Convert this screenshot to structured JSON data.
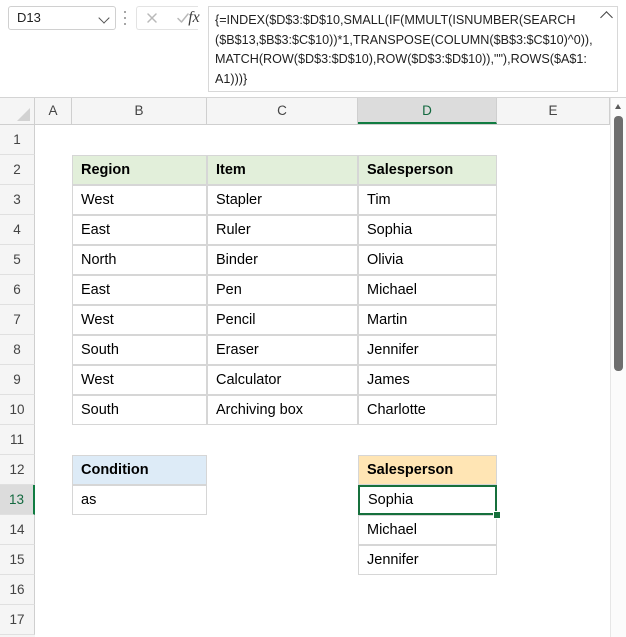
{
  "app": "excel-spreadsheet",
  "formula_bar": {
    "name_box_value": "D13",
    "name_box_icon": "chevron-down-icon",
    "cancel_icon": "cancel-x-icon",
    "enter_icon": "enter-check-icon",
    "fx_label": "fx",
    "formula": "{=INDEX($D$3:$D$10,SMALL(IF(MMULT(ISNUMBER(SEARCH($B$13,$B$3:$C$10))*1,TRANSPOSE(COLUMN($B$3:$C$10)^0)),MATCH(ROW($D$3:$D$10),ROW($D$3:$D$10)),\"\"),ROWS($A$1:A1)))}",
    "collapse_icon": "chevron-up-icon"
  },
  "grid": {
    "column_headers": [
      "A",
      "B",
      "C",
      "D",
      "E"
    ],
    "active_column": "D",
    "row_headers": [
      "1",
      "2",
      "3",
      "4",
      "5",
      "6",
      "7",
      "8",
      "9",
      "10",
      "11",
      "12",
      "13",
      "14",
      "15",
      "16",
      "17"
    ],
    "active_row": "13",
    "select_all_icon": "select-all-triangle-icon"
  },
  "data_table": {
    "headers": [
      "Region",
      "Item",
      "Salesperson"
    ],
    "rows": [
      {
        "region": "West",
        "item": "Stapler",
        "salesperson": "Tim"
      },
      {
        "region": "East",
        "item": "Ruler",
        "salesperson": "Sophia"
      },
      {
        "region": "North",
        "item": "Binder",
        "salesperson": "Olivia"
      },
      {
        "region": "East",
        "item": "Pen",
        "salesperson": "Michael"
      },
      {
        "region": "West",
        "item": "Pencil",
        "salesperson": "Martin"
      },
      {
        "region": "South",
        "item": "Eraser",
        "salesperson": "Jennifer"
      },
      {
        "region": "West",
        "item": "Calculator",
        "salesperson": "James"
      },
      {
        "region": "South",
        "item": "Archiving box",
        "salesperson": "Charlotte"
      }
    ]
  },
  "condition_table": {
    "header": "Condition",
    "value": "as"
  },
  "result_table": {
    "header": "Salesperson",
    "values": [
      "Sophia",
      "Michael",
      "Jennifer"
    ],
    "selected_value": "Sophia"
  },
  "colors": {
    "header_green": "#E2EFDA",
    "header_blue": "#DDEBF7",
    "header_orange": "#FFE5B4",
    "selection_green": "#16703C",
    "grid_border": "#D6D6D6"
  },
  "scrollbar": {
    "up_arrow_icon": "scroll-up-arrow-icon"
  }
}
